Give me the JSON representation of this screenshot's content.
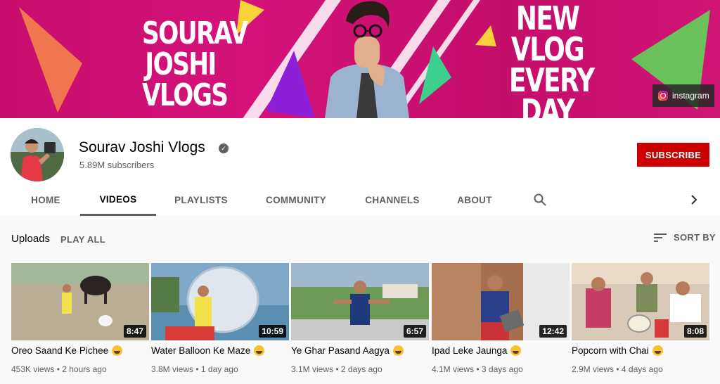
{
  "banner": {
    "title_lines": "SOURAV JOSHI VLOGS",
    "tagline": "NEW VLOG EVERY DAY",
    "instagram_label": "instagram",
    "brand_color": "#cc0f6b"
  },
  "channel": {
    "name": "Sourav Joshi Vlogs",
    "subscribers": "5.89M subscribers",
    "subscribe_label": "SUBSCRIBE",
    "subscribe_color": "#cc0000"
  },
  "tabs": [
    {
      "label": "HOME",
      "active": false
    },
    {
      "label": "VIDEOS",
      "active": true
    },
    {
      "label": "PLAYLISTS",
      "active": false
    },
    {
      "label": "COMMUNITY",
      "active": false
    },
    {
      "label": "CHANNELS",
      "active": false
    },
    {
      "label": "ABOUT",
      "active": false
    }
  ],
  "icons": {
    "search": "search-icon",
    "next": "chevron-right-icon",
    "sort": "sort-icon",
    "verified": "verified-check-icon"
  },
  "uploads": {
    "title": "Uploads",
    "play_all": "PLAY ALL",
    "sort_by": "SORT BY"
  },
  "videos": [
    {
      "title": "Oreo Saand Ke Pichee",
      "emoji": "grinning-sweat-emoji",
      "duration": "8:47",
      "views": "453K views",
      "age": "2 hours ago"
    },
    {
      "title": "Water Balloon Ke Maze",
      "emoji": "star-struck-emoji",
      "duration": "10:59",
      "views": "3.8M views",
      "age": "1 day ago"
    },
    {
      "title": "Ye Ghar Pasand Aagya",
      "emoji": "star-struck-emoji",
      "duration": "6:57",
      "views": "3.1M views",
      "age": "2 days ago"
    },
    {
      "title": "Ipad Leke Jaunga",
      "emoji": "smiling-emoji",
      "duration": "12:42",
      "views": "4.1M views",
      "age": "3 days ago"
    },
    {
      "title": "Popcorn with Chai",
      "emoji": "smiling-emoji",
      "duration": "8:08",
      "views": "2.9M views",
      "age": "4 days ago"
    }
  ]
}
